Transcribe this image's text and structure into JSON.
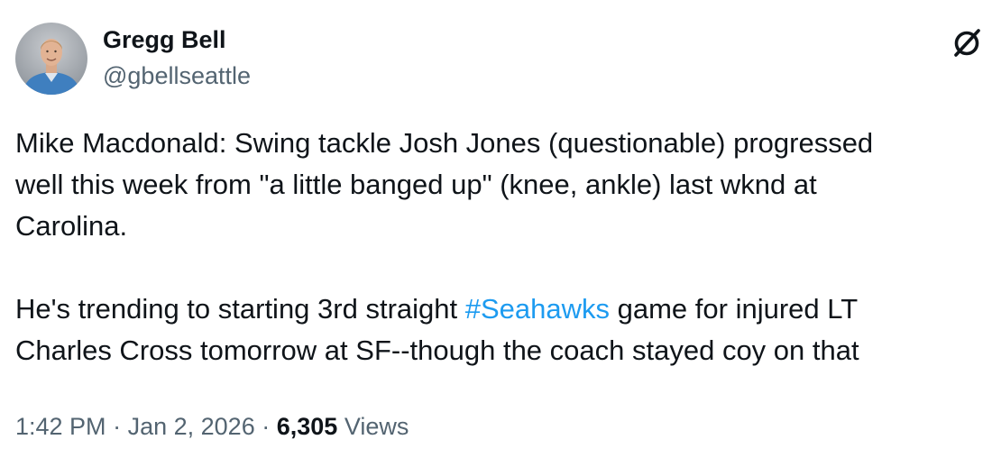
{
  "author": {
    "display_name": "Gregg Bell",
    "handle": "@gbellseattle",
    "avatar_icon": "person-photo"
  },
  "logo_icon": "x-logo-icon",
  "tweet": {
    "paragraph1": [
      "Mike Macdonald: Swing tackle Josh Jones (questionable) progressed",
      "well this week from \"a little banged up\" (knee, ankle) last wknd at",
      "Carolina."
    ],
    "paragraph2_line1_before": "He's trending to starting 3rd straight ",
    "hashtag": "#Seahawks",
    "paragraph2_line1_after": " game for injured LT",
    "paragraph2_line2": "Charles Cross tomorrow at SF--though the coach stayed coy on that"
  },
  "meta": {
    "time": "1:42 PM",
    "separator": "·",
    "date": "Jan 2, 2026",
    "views_count": "6,305",
    "views_label": "Views"
  },
  "colors": {
    "text": "#0f1419",
    "secondary": "#536471",
    "link": "#1d9bf0"
  }
}
